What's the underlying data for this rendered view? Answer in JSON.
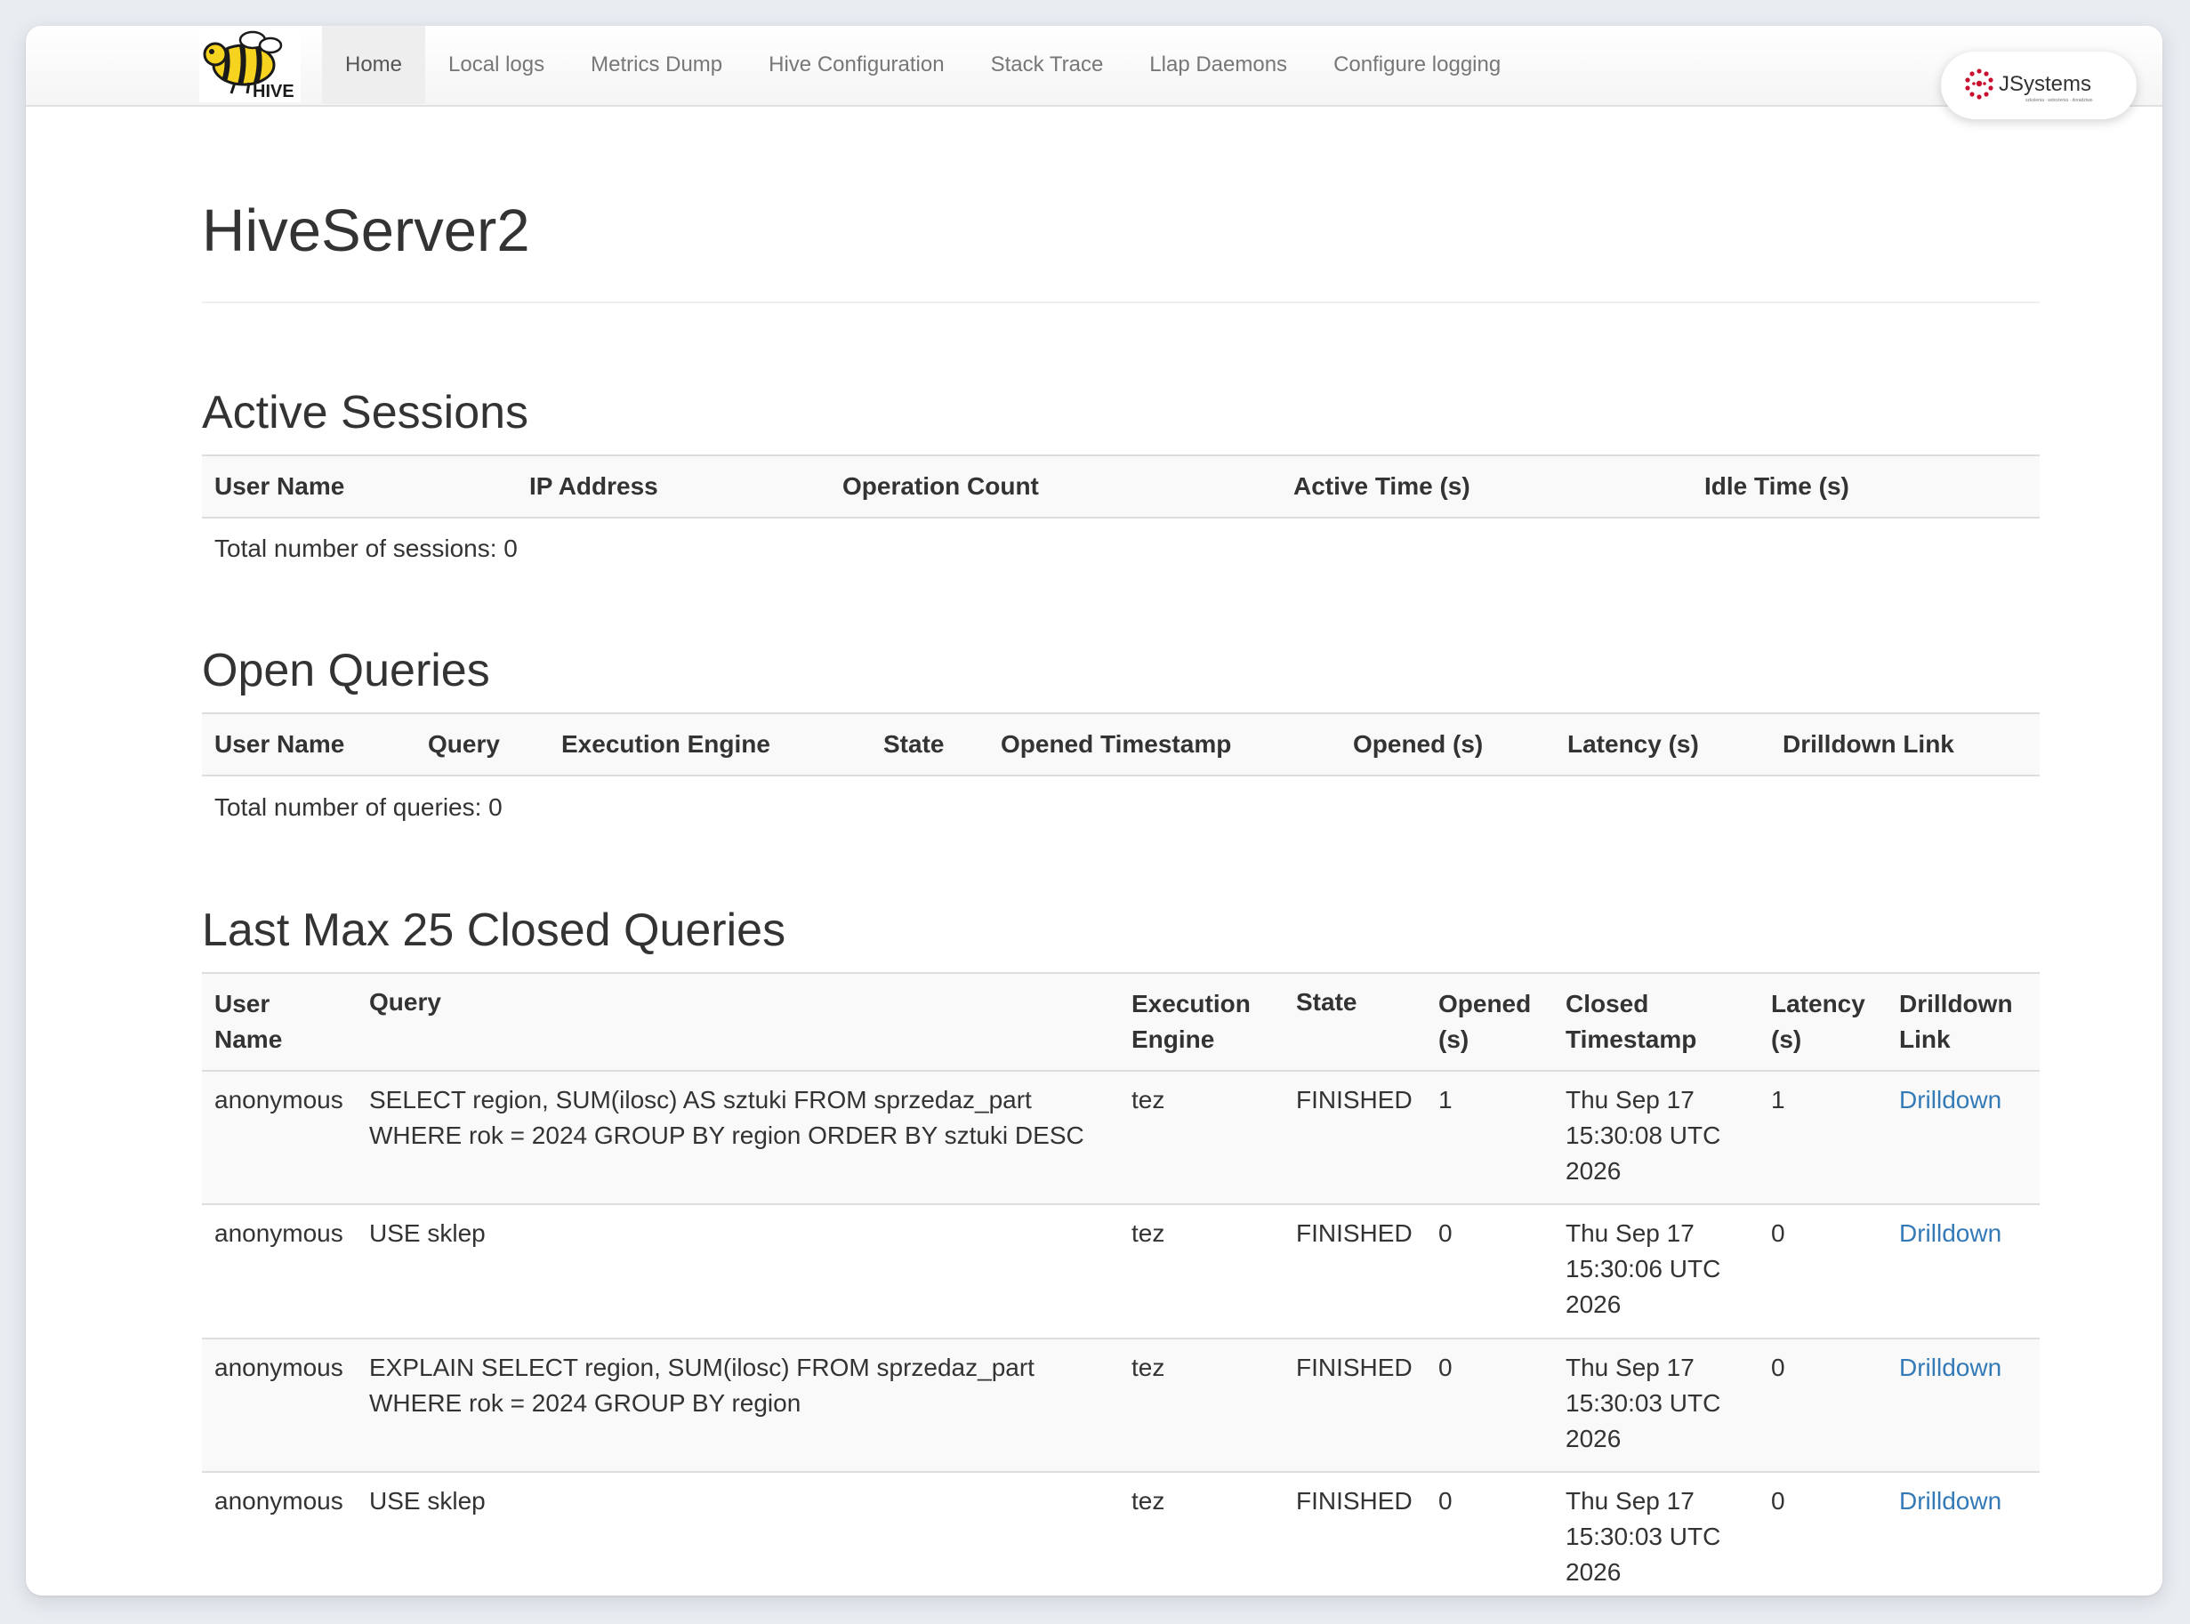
{
  "nav": {
    "brand_text": "HIVE",
    "links": [
      "Home",
      "Local logs",
      "Metrics Dump",
      "Hive Configuration",
      "Stack Trace",
      "Llap Daemons",
      "Configure logging"
    ],
    "active": "Home"
  },
  "badge": {
    "logo_text": "JSystems",
    "logo_subtext": "szkolenia · wdrożenia · doradztwo"
  },
  "page": {
    "title": "HiveServer2"
  },
  "active_sessions": {
    "heading": "Active Sessions",
    "columns": [
      "User Name",
      "IP Address",
      "Operation Count",
      "Active Time (s)",
      "Idle Time (s)"
    ],
    "total": "Total number of sessions: 0"
  },
  "open_queries": {
    "heading": "Open Queries",
    "columns": [
      "User Name",
      "Query",
      "Execution Engine",
      "State",
      "Opened Timestamp",
      "Opened (s)",
      "Latency (s)",
      "Drilldown Link"
    ],
    "total": "Total number of queries: 0"
  },
  "closed_queries": {
    "heading": "Last Max 25 Closed Queries",
    "columns": [
      "User Name",
      "Query",
      "Execution Engine",
      "State",
      "Opened (s)",
      "Closed Timestamp",
      "Latency (s)",
      "Drilldown Link"
    ],
    "rows": [
      {
        "user": "anonymous",
        "query": "SELECT region, SUM(ilosc) AS sztuki FROM sprzedaz_part WHERE rok = 2024 GROUP BY region ORDER BY sztuki DESC",
        "engine": "tez",
        "state": "FINISHED",
        "opened": "1",
        "closed": "Thu Sep 17 15:30:08 UTC 2026",
        "latency": "1",
        "link": "Drilldown"
      },
      {
        "user": "anonymous",
        "query": "USE sklep",
        "engine": "tez",
        "state": "FINISHED",
        "opened": "0",
        "closed": "Thu Sep 17 15:30:06 UTC 2026",
        "latency": "0",
        "link": "Drilldown"
      },
      {
        "user": "anonymous",
        "query": "EXPLAIN SELECT region, SUM(ilosc) FROM sprzedaz_part WHERE rok = 2024 GROUP BY region",
        "engine": "tez",
        "state": "FINISHED",
        "opened": "0",
        "closed": "Thu Sep 17 15:30:03 UTC 2026",
        "latency": "0",
        "link": "Drilldown"
      },
      {
        "user": "anonymous",
        "query": "USE sklep",
        "engine": "tez",
        "state": "FINISHED",
        "opened": "0",
        "closed": "Thu Sep 17 15:30:03 UTC 2026",
        "latency": "0",
        "link": "Drilldown"
      }
    ]
  },
  "colors": {
    "link": "#337ab7",
    "text": "#333333",
    "nav_text": "#777777",
    "logo_yellow": "#f6d31f",
    "logo_red": "#c8102e"
  }
}
